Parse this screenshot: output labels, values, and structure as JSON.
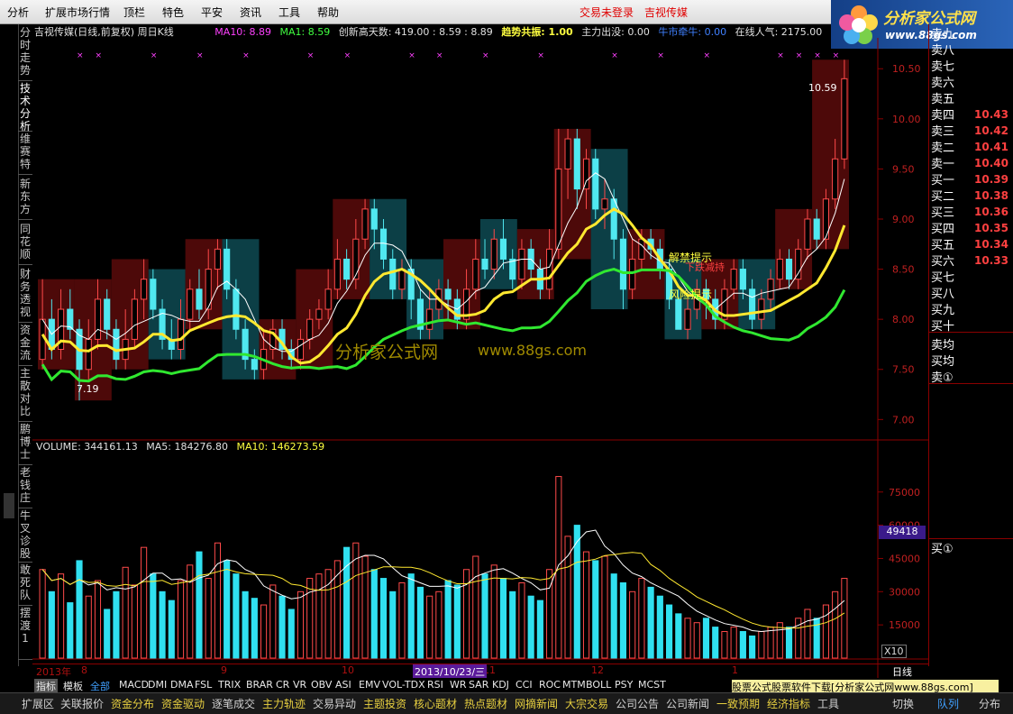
{
  "menu": {
    "items": [
      "分析",
      "扩展市场行情",
      "顶栏",
      "特色",
      "平安",
      "资讯",
      "工具",
      "帮助"
    ],
    "login_status": "交易未登录",
    "stock_name": "吉视传媒"
  },
  "logo": {
    "title": "分析家公式网",
    "url": "www.88gs.com"
  },
  "left_tabs": [
    "分时走势",
    "技术分析",
    "维赛特",
    "新东方",
    "同花顺",
    "财务透视",
    "资金流",
    "主散对比",
    "鹏博士",
    "老钱庄",
    "牛叉诊股",
    "敢死队",
    "摆渡1"
  ],
  "info": {
    "title": "吉视传媒(日线,前复权) 周日K线",
    "ma10": "MA10: 8.89",
    "ma1": "MA1: 8.59",
    "new_high": "创新高天数: 419.00 : 8.59 : 8.89",
    "trend": "趋势共振: 1.00",
    "main_out": "主力出没: 0.00",
    "bull": "牛市牵牛: 0.00",
    "online": "在线人气: 2175.00"
  },
  "volume_info": {
    "volume": "VOLUME: 344161.13",
    "ma5": "MA5: 184276.80",
    "ma10": "MA10: 146273.59"
  },
  "chart_labels": {
    "high": "10.59",
    "low": "7.19",
    "watermark_cn": "分析家公式网",
    "watermark_url": "www.88gs.com",
    "tip1": "解禁提示",
    "tip1b": "下跌减持",
    "tip2": "风险提示",
    "current_volume": "49418",
    "x10": "X10",
    "date_cursor": "2013/10/23/三",
    "x_year": "2013年",
    "x_ticks": [
      "8",
      "9",
      "10",
      "11",
      "12",
      "1"
    ],
    "period": "日线"
  },
  "order_book": {
    "sell_labels": [
      "卖九",
      "卖八",
      "卖七",
      "卖六",
      "卖五",
      "卖四",
      "卖三",
      "卖二",
      "卖一"
    ],
    "sell_prices": [
      "",
      "",
      "",
      "",
      "10.43",
      "10.42",
      "10.41",
      "10.40",
      "10.39"
    ],
    "buy_labels": [
      "买一",
      "买二",
      "买三",
      "买四",
      "买五",
      "买六",
      "买七",
      "买八",
      "买九",
      "买十"
    ],
    "buy_prices": [
      "10.38",
      "10.36",
      "10.35",
      "10.34",
      "10.33",
      "",
      "",
      "",
      "",
      ""
    ],
    "avg_sell": "卖均",
    "avg_buy": "买均",
    "sell1_circle": "卖①",
    "buy1_circle": "买①"
  },
  "indicator_bar": [
    "指标",
    "模板",
    "全部",
    "MACD",
    "DMI",
    "DMA",
    "FSL",
    "TRIX",
    "BRAR",
    "CR",
    "VR",
    "OBV",
    "ASI",
    "EMV",
    "VOL-TDX",
    "RSI",
    "WR",
    "SAR",
    "KDJ",
    "CCI",
    "ROC",
    "MTM",
    "BOLL",
    "PSY",
    "MCST"
  ],
  "download_banner": "股票公式股票软件下载[分析家公式网www.88gs.com]",
  "bottom_bar": [
    "扩展区",
    "关联报价",
    "资金分布",
    "资金驱动",
    "逐笔成交",
    "主力轨迹",
    "交易异动",
    "主题投资",
    "核心题材",
    "热点题材",
    "网摘新闻",
    "大宗交易",
    "公司公告",
    "公司新闻",
    "一致预期",
    "经济指标",
    "工具",
    "切换",
    "队列",
    "分布"
  ],
  "chart_data": {
    "type": "candlestick",
    "y_axis": {
      "ticks": [
        "10.50",
        "10.00",
        "9.50",
        "9.00",
        "8.50",
        "8.00",
        "7.50",
        "7.00"
      ],
      "ylim": [
        6.85,
        10.7
      ]
    },
    "volume_axis": {
      "ticks": [
        "75000",
        "60000",
        "45000",
        "30000",
        "15000"
      ],
      "ylim": [
        0,
        92000
      ]
    },
    "candles": [
      [
        7.6,
        8.0,
        7.5,
        8.4
      ],
      [
        8.0,
        7.7,
        7.6,
        8.2
      ],
      [
        7.7,
        8.1,
        7.6,
        8.3
      ],
      [
        8.1,
        7.9,
        7.8,
        8.3
      ],
      [
        7.9,
        7.5,
        7.19,
        8.0
      ],
      [
        7.5,
        7.8,
        7.4,
        8.0
      ],
      [
        7.8,
        8.2,
        7.7,
        8.4
      ],
      [
        8.2,
        7.9,
        7.8,
        8.3
      ],
      [
        7.9,
        7.6,
        7.5,
        8.0
      ],
      [
        7.6,
        7.8,
        7.5,
        8.1
      ],
      [
        7.8,
        8.2,
        7.7,
        8.3
      ],
      [
        8.2,
        8.4,
        8.0,
        8.6
      ],
      [
        8.4,
        8.1,
        8.0,
        8.5
      ],
      [
        8.1,
        7.8,
        7.7,
        8.2
      ],
      [
        7.8,
        7.7,
        7.6,
        8.0
      ],
      [
        7.7,
        8.0,
        7.6,
        8.2
      ],
      [
        8.0,
        8.3,
        7.9,
        8.4
      ],
      [
        8.3,
        8.1,
        8.0,
        8.5
      ],
      [
        8.1,
        8.5,
        8.0,
        8.7
      ],
      [
        8.5,
        8.7,
        8.3,
        8.8
      ],
      [
        8.7,
        8.3,
        8.2,
        8.8
      ],
      [
        8.3,
        7.9,
        7.8,
        8.4
      ],
      [
        7.9,
        7.6,
        7.5,
        8.0
      ],
      [
        7.6,
        7.5,
        7.4,
        7.7
      ],
      [
        7.5,
        7.7,
        7.4,
        7.9
      ],
      [
        7.7,
        7.9,
        7.6,
        8.0
      ],
      [
        7.9,
        7.7,
        7.6,
        8.0
      ],
      [
        7.7,
        7.6,
        7.5,
        7.8
      ],
      [
        7.6,
        7.8,
        7.5,
        7.9
      ],
      [
        7.8,
        8.0,
        7.7,
        8.1
      ],
      [
        8.0,
        8.1,
        7.9,
        8.2
      ],
      [
        8.1,
        8.3,
        8.0,
        8.5
      ],
      [
        8.3,
        8.6,
        8.2,
        8.8
      ],
      [
        8.6,
        8.4,
        8.3,
        8.7
      ],
      [
        8.4,
        8.8,
        8.3,
        9.0
      ],
      [
        8.8,
        9.1,
        8.7,
        9.2
      ],
      [
        9.1,
        8.9,
        8.7,
        9.2
      ],
      [
        8.9,
        8.6,
        8.5,
        9.0
      ],
      [
        8.6,
        8.3,
        8.2,
        8.7
      ],
      [
        8.3,
        8.5,
        8.2,
        8.6
      ],
      [
        8.5,
        8.2,
        8.0,
        8.6
      ],
      [
        8.2,
        7.9,
        7.8,
        8.3
      ],
      [
        7.9,
        8.1,
        7.8,
        8.3
      ],
      [
        8.1,
        8.3,
        8.0,
        8.4
      ],
      [
        8.3,
        8.2,
        8.0,
        8.4
      ],
      [
        8.2,
        8.0,
        7.9,
        8.3
      ],
      [
        8.0,
        8.3,
        7.9,
        8.5
      ],
      [
        8.3,
        8.6,
        8.2,
        8.8
      ],
      [
        8.6,
        8.5,
        8.4,
        8.8
      ],
      [
        8.5,
        8.8,
        8.4,
        8.9
      ],
      [
        8.8,
        8.6,
        8.5,
        9.0
      ],
      [
        8.6,
        8.4,
        8.3,
        8.7
      ],
      [
        8.4,
        8.7,
        8.3,
        8.8
      ],
      [
        8.7,
        8.5,
        8.4,
        8.8
      ],
      [
        8.5,
        8.3,
        8.2,
        8.6
      ],
      [
        8.3,
        8.7,
        8.2,
        8.9
      ],
      [
        8.7,
        9.5,
        8.6,
        9.9
      ],
      [
        9.5,
        9.8,
        9.2,
        9.9
      ],
      [
        9.8,
        9.3,
        9.1,
        9.9
      ],
      [
        9.3,
        9.6,
        9.1,
        9.7
      ],
      [
        9.6,
        9.1,
        9.0,
        9.7
      ],
      [
        9.1,
        9.2,
        8.9,
        9.4
      ],
      [
        9.2,
        8.8,
        8.6,
        9.3
      ],
      [
        8.8,
        8.3,
        8.1,
        8.9
      ],
      [
        8.3,
        8.6,
        8.2,
        8.8
      ],
      [
        8.6,
        8.8,
        8.5,
        8.9
      ],
      [
        8.8,
        8.7,
        8.6,
        8.9
      ],
      [
        8.7,
        8.5,
        8.4,
        8.8
      ],
      [
        8.5,
        8.2,
        8.1,
        8.6
      ],
      [
        8.2,
        7.9,
        7.9,
        8.3
      ],
      [
        7.9,
        8.1,
        7.8,
        8.2
      ],
      [
        8.1,
        8.3,
        8.0,
        8.4
      ],
      [
        8.3,
        8.2,
        8.0,
        8.4
      ],
      [
        8.2,
        8.0,
        7.9,
        8.3
      ],
      [
        8.0,
        8.3,
        7.9,
        8.4
      ],
      [
        8.3,
        8.5,
        8.2,
        8.6
      ],
      [
        8.5,
        8.3,
        8.2,
        8.6
      ],
      [
        8.3,
        8.0,
        7.9,
        8.4
      ],
      [
        8.0,
        8.2,
        7.9,
        8.3
      ],
      [
        8.2,
        8.4,
        8.1,
        8.5
      ],
      [
        8.4,
        8.6,
        8.3,
        8.7
      ],
      [
        8.6,
        8.4,
        8.3,
        8.7
      ],
      [
        8.4,
        8.7,
        8.3,
        8.8
      ],
      [
        8.7,
        9.0,
        8.6,
        9.1
      ],
      [
        9.0,
        8.8,
        8.7,
        9.1
      ],
      [
        8.8,
        9.2,
        8.7,
        9.3
      ],
      [
        9.2,
        9.6,
        9.1,
        9.8
      ],
      [
        9.6,
        10.4,
        9.5,
        10.59
      ]
    ],
    "volume": [
      40,
      30,
      38,
      25,
      44,
      28,
      35,
      22,
      30,
      41,
      33,
      50,
      38,
      30,
      26,
      35,
      42,
      48,
      36,
      52,
      44,
      38,
      30,
      27,
      24,
      33,
      28,
      22,
      30,
      36,
      38,
      40,
      44,
      50,
      52,
      46,
      40,
      36,
      30,
      34,
      38,
      32,
      28,
      30,
      35,
      33,
      40,
      46,
      38,
      42,
      36,
      30,
      34,
      28,
      26,
      40,
      82,
      55,
      60,
      48,
      44,
      46,
      38,
      34,
      30,
      36,
      32,
      28,
      24,
      20,
      18,
      16,
      18,
      14,
      12,
      14,
      12,
      10,
      12,
      14,
      16,
      14,
      18,
      22,
      18,
      24,
      30,
      36
    ]
  }
}
